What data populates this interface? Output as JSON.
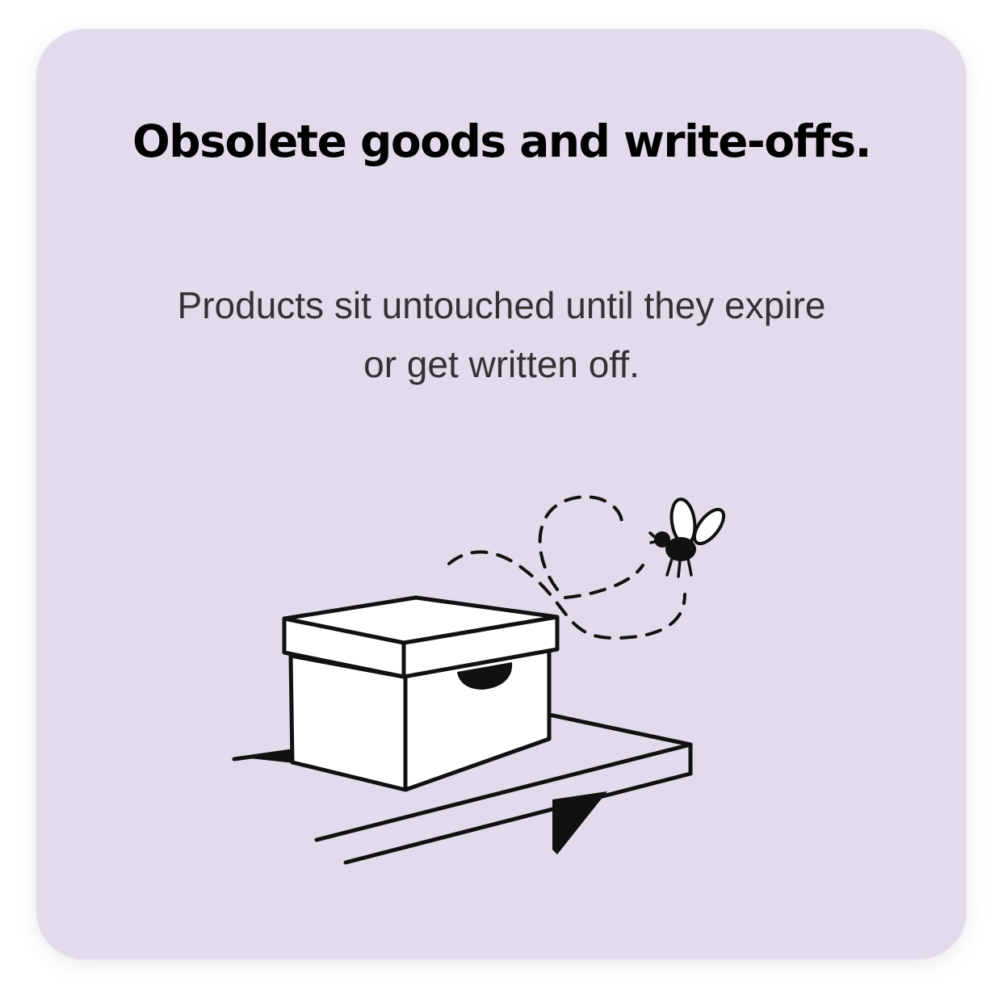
{
  "card": {
    "background": "#e2dbeb",
    "title": "Obsolete goods and write-offs.",
    "body_lines": [
      "Products sit untouched until they expire",
      "or get written off."
    ],
    "text_color": "#333136",
    "ink_color": "#111111",
    "paper_color": "#ffffff"
  },
  "illustration": {
    "subject": "storage-box-on-shelf-with-fly",
    "icons": [
      "box-icon",
      "shelf-icon",
      "fly-icon",
      "dashed-flight-path"
    ]
  }
}
